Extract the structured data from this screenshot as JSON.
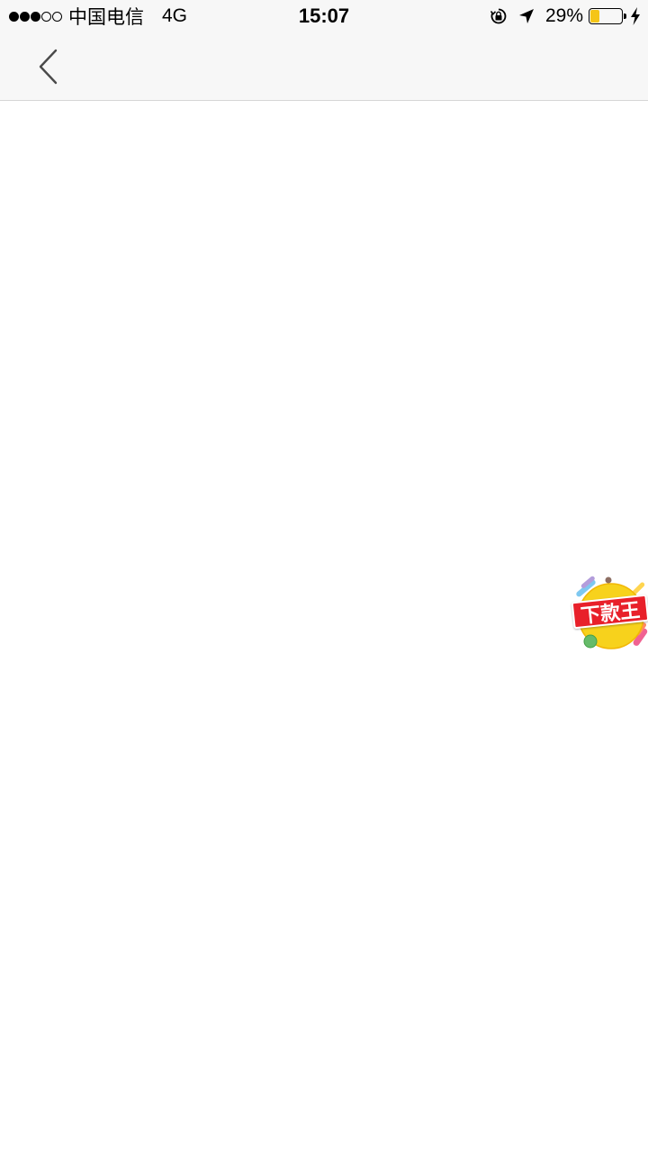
{
  "status_bar": {
    "carrier": "中国电信",
    "network": "4G",
    "time": "15:07",
    "battery_percent": "29%",
    "battery_level": 0.29,
    "signal_bars_filled": 3,
    "signal_bars_total": 5,
    "icons": [
      "rotation-lock-icon",
      "location-arrow-icon",
      "battery-icon",
      "charging-bolt-icon"
    ]
  },
  "nav_bar": {
    "back_icon": "chevron-left-icon"
  },
  "floating_badge": {
    "label": "下款王"
  },
  "colors": {
    "status_bg": "#f7f7f7",
    "nav_bg": "#f7f7f7",
    "content_bg": "#ffffff",
    "battery_fill": "#f5c518",
    "badge_red": "#e8202a",
    "badge_yellow": "#f7d21c"
  }
}
